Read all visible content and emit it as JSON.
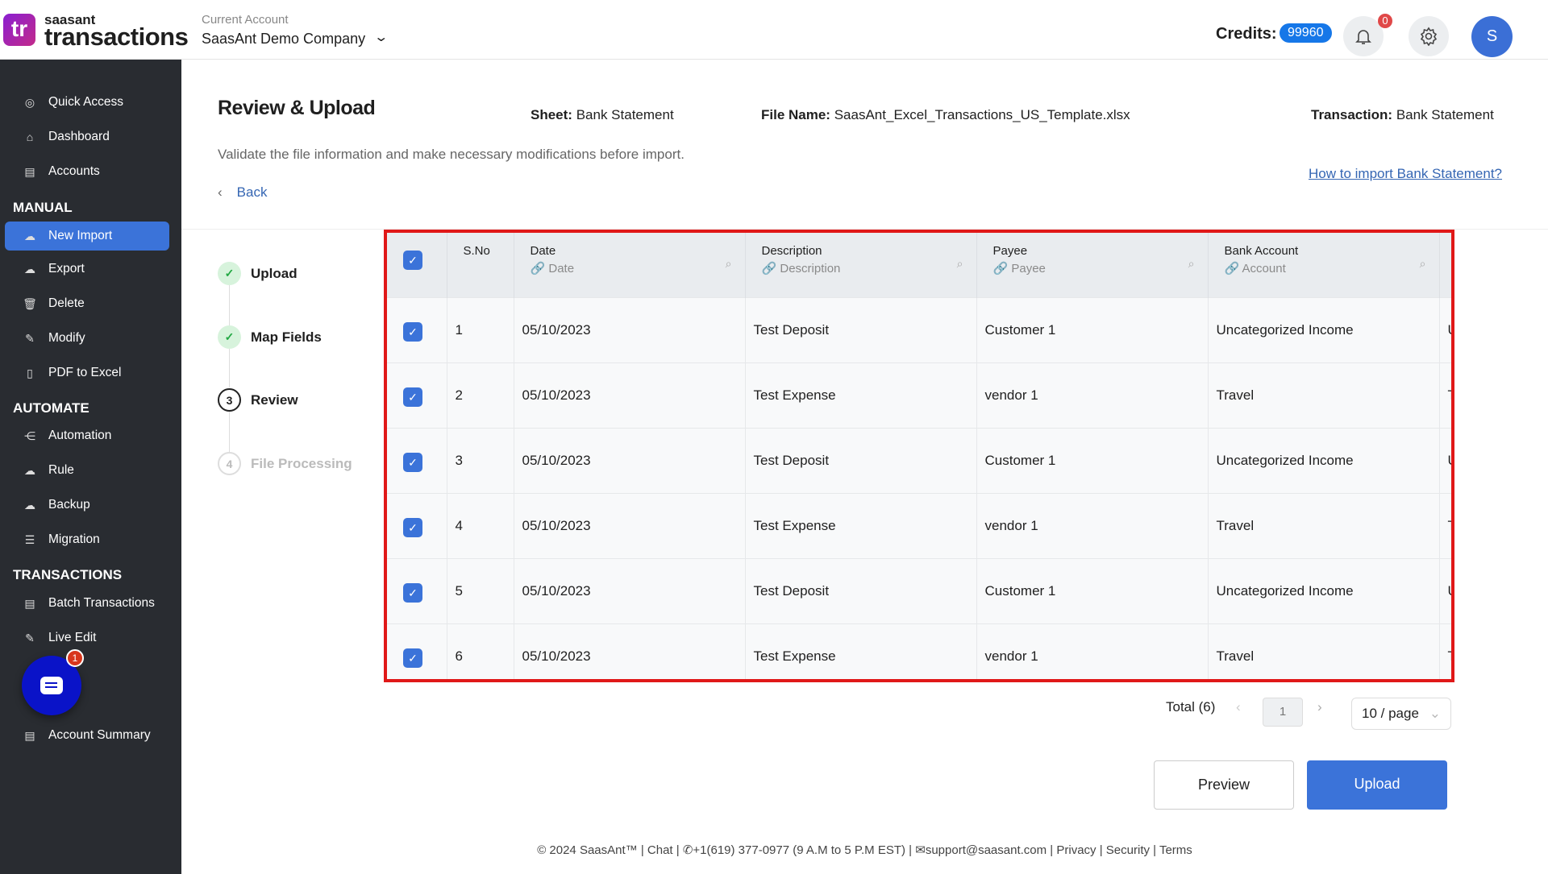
{
  "header": {
    "logo_text": "tr",
    "brand_top": "saasant",
    "brand_main": "transactions",
    "account_label": "Current Account",
    "account_name": "SaasAnt Demo Company",
    "credits_label": "Credits:",
    "credits_value": "99960",
    "notifications": "0",
    "avatar": "S"
  },
  "sidebar": {
    "items_top": [
      {
        "label": "Quick Access"
      },
      {
        "label": "Dashboard"
      },
      {
        "label": "Accounts"
      }
    ],
    "manual_title": "MANUAL",
    "manual": [
      {
        "label": "New Import"
      },
      {
        "label": "Export"
      },
      {
        "label": "Delete"
      },
      {
        "label": "Modify"
      },
      {
        "label": "PDF to Excel"
      }
    ],
    "automate_title": "AUTOMATE",
    "automate": [
      {
        "label": "Automation"
      },
      {
        "label": "Rule"
      },
      {
        "label": "Backup"
      },
      {
        "label": "Migration"
      }
    ],
    "transactions_title": "TRANSACTIONS",
    "transactions": [
      {
        "label": "Batch Transactions"
      },
      {
        "label": "Live Edit"
      }
    ],
    "reports": [
      {
        "label": "Account Summary"
      }
    ]
  },
  "chat": {
    "badge": "1"
  },
  "page": {
    "title": "Review & Upload",
    "sheet_label": "Sheet:",
    "sheet": "Bank Statement",
    "file_label": "File Name:",
    "file": "SaasAnt_Excel_Transactions_US_Template.xlsx",
    "txn_label": "Transaction:",
    "txn": "Bank Statement",
    "subtitle": "Validate the file information and make necessary modifications before import.",
    "back": "Back",
    "help_link": "How to import Bank Statement?"
  },
  "steps": [
    {
      "label": "Upload",
      "state": "done"
    },
    {
      "label": "Map Fields",
      "state": "done"
    },
    {
      "label": "Review",
      "num": "3",
      "state": "current"
    },
    {
      "label": "File Processing",
      "num": "4",
      "state": "todo"
    }
  ],
  "table": {
    "sno_header": "S.No",
    "columns": [
      {
        "name": "Date",
        "mapped": "Date"
      },
      {
        "name": "Description",
        "mapped": "Description"
      },
      {
        "name": "Payee",
        "mapped": "Payee"
      },
      {
        "name": "Bank Account",
        "mapped": "Account"
      }
    ],
    "rows": [
      {
        "sno": "1",
        "date": "05/10/2023",
        "desc": "Test Deposit",
        "payee": "Customer 1",
        "account": "Uncategorized Income",
        "extra": "U"
      },
      {
        "sno": "2",
        "date": "05/10/2023",
        "desc": "Test Expense",
        "payee": "vendor 1",
        "account": "Travel",
        "extra": "T"
      },
      {
        "sno": "3",
        "date": "05/10/2023",
        "desc": "Test Deposit",
        "payee": "Customer 1",
        "account": "Uncategorized Income",
        "extra": "U"
      },
      {
        "sno": "4",
        "date": "05/10/2023",
        "desc": "Test Expense",
        "payee": "vendor 1",
        "account": "Travel",
        "extra": "T"
      },
      {
        "sno": "5",
        "date": "05/10/2023",
        "desc": "Test Deposit",
        "payee": "Customer 1",
        "account": "Uncategorized Income",
        "extra": "U"
      },
      {
        "sno": "6",
        "date": "05/10/2023",
        "desc": "Test Expense",
        "payee": "vendor 1",
        "account": "Travel",
        "extra": "T"
      }
    ]
  },
  "pagination": {
    "total": "Total (6)",
    "page": "1",
    "per_page": "10 / page"
  },
  "actions": {
    "preview": "Preview",
    "upload": "Upload"
  },
  "footer": {
    "copyright": "© 2024 SaasAnt™",
    "chat": "Chat",
    "phone": "+1(619) 377-0977 (9 A.M to 5 P.M EST)",
    "email": "support@saasant.com",
    "privacy": "Privacy",
    "security": "Security",
    "terms": "Terms"
  },
  "colors": {
    "accent": "#3b73d9",
    "sidebar": "#292c31",
    "highlight": "#e01818"
  }
}
